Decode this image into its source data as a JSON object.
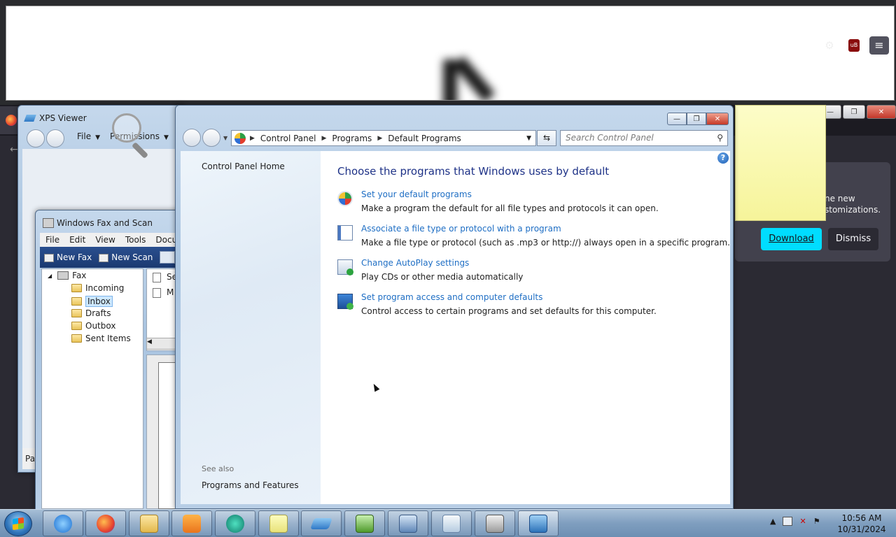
{
  "firefox": {
    "panel_text_line1": "ne new",
    "panel_text_line2": "stomizations.",
    "download_label": "Download",
    "dismiss_label": "Dismiss",
    "ublock_label": "uB"
  },
  "xps_viewer": {
    "title": "XPS Viewer",
    "menu": [
      "File",
      "Permissions"
    ],
    "status_text": "Pa"
  },
  "fax_scan": {
    "title": "Windows Fax and Scan",
    "menu": [
      "File",
      "Edit",
      "View",
      "Tools",
      "Docum"
    ],
    "toolbar": [
      "New Fax",
      "New Scan"
    ],
    "tree_root": "Fax",
    "tree_items": [
      "Incoming",
      "Inbox",
      "Drafts",
      "Outbox",
      "Sent Items"
    ],
    "selected_item": "Inbox",
    "list_rows": [
      "Se",
      "M"
    ]
  },
  "control_panel": {
    "breadcrumbs": [
      "Control Panel",
      "Programs",
      "Default Programs"
    ],
    "search_placeholder": "Search Control Panel",
    "sidebar_home": "Control Panel Home",
    "see_also": "See also",
    "programs_features": "Programs and Features",
    "heading": "Choose the programs that Windows uses by default",
    "items": [
      {
        "link": "Set your default programs",
        "desc": "Make a program the default for all file types and protocols it can open.",
        "icon": "default-programs-icon"
      },
      {
        "link": "Associate a file type or protocol with a program",
        "desc": "Make a file type or protocol (such as .mp3 or http://) always open in a specific program.",
        "icon": "file-association-icon"
      },
      {
        "link": "Change AutoPlay settings",
        "desc": "Play CDs or other media automatically",
        "icon": "autoplay-icon"
      },
      {
        "link": "Set program access and computer defaults",
        "desc": "Control access to certain programs and set defaults for this computer.",
        "icon": "program-access-icon"
      }
    ]
  },
  "taskbar": {
    "apps": [
      "internet-explorer",
      "firefox",
      "windows-explorer",
      "media-player",
      "browser-app",
      "sticky-notes",
      "xps-viewer",
      "greenshot-app",
      "fax-scan",
      "paper-document-app",
      "printer-app",
      "control-panel"
    ],
    "time": "10:56 AM",
    "date": "10/31/2024"
  }
}
